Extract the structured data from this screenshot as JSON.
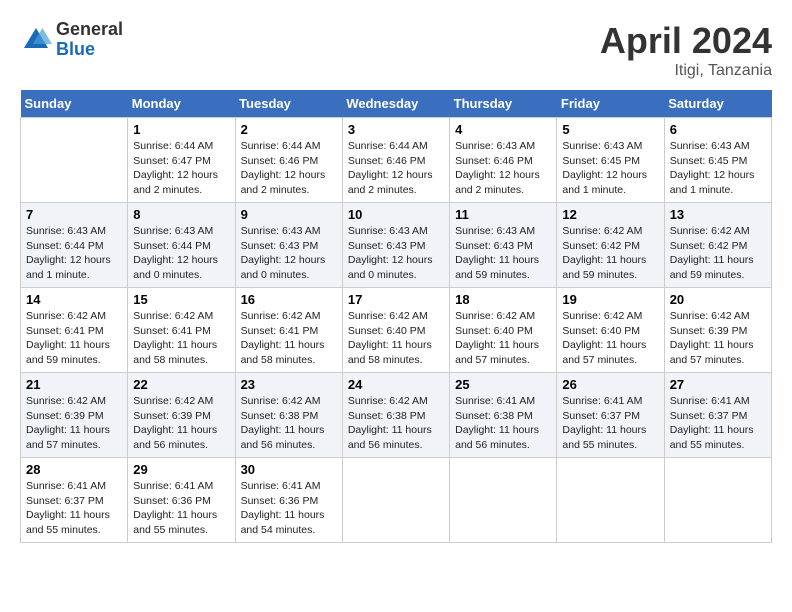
{
  "header": {
    "logo_general": "General",
    "logo_blue": "Blue",
    "month_title": "April 2024",
    "location": "Itigi, Tanzania"
  },
  "calendar": {
    "headers": [
      "Sunday",
      "Monday",
      "Tuesday",
      "Wednesday",
      "Thursday",
      "Friday",
      "Saturday"
    ],
    "weeks": [
      [
        {
          "day": "",
          "info": ""
        },
        {
          "day": "1",
          "info": "Sunrise: 6:44 AM\nSunset: 6:47 PM\nDaylight: 12 hours\nand 2 minutes."
        },
        {
          "day": "2",
          "info": "Sunrise: 6:44 AM\nSunset: 6:46 PM\nDaylight: 12 hours\nand 2 minutes."
        },
        {
          "day": "3",
          "info": "Sunrise: 6:44 AM\nSunset: 6:46 PM\nDaylight: 12 hours\nand 2 minutes."
        },
        {
          "day": "4",
          "info": "Sunrise: 6:43 AM\nSunset: 6:46 PM\nDaylight: 12 hours\nand 2 minutes."
        },
        {
          "day": "5",
          "info": "Sunrise: 6:43 AM\nSunset: 6:45 PM\nDaylight: 12 hours\nand 1 minute."
        },
        {
          "day": "6",
          "info": "Sunrise: 6:43 AM\nSunset: 6:45 PM\nDaylight: 12 hours\nand 1 minute."
        }
      ],
      [
        {
          "day": "7",
          "info": "Sunrise: 6:43 AM\nSunset: 6:44 PM\nDaylight: 12 hours\nand 1 minute."
        },
        {
          "day": "8",
          "info": "Sunrise: 6:43 AM\nSunset: 6:44 PM\nDaylight: 12 hours\nand 0 minutes."
        },
        {
          "day": "9",
          "info": "Sunrise: 6:43 AM\nSunset: 6:43 PM\nDaylight: 12 hours\nand 0 minutes."
        },
        {
          "day": "10",
          "info": "Sunrise: 6:43 AM\nSunset: 6:43 PM\nDaylight: 12 hours\nand 0 minutes."
        },
        {
          "day": "11",
          "info": "Sunrise: 6:43 AM\nSunset: 6:43 PM\nDaylight: 11 hours\nand 59 minutes."
        },
        {
          "day": "12",
          "info": "Sunrise: 6:42 AM\nSunset: 6:42 PM\nDaylight: 11 hours\nand 59 minutes."
        },
        {
          "day": "13",
          "info": "Sunrise: 6:42 AM\nSunset: 6:42 PM\nDaylight: 11 hours\nand 59 minutes."
        }
      ],
      [
        {
          "day": "14",
          "info": "Sunrise: 6:42 AM\nSunset: 6:41 PM\nDaylight: 11 hours\nand 59 minutes."
        },
        {
          "day": "15",
          "info": "Sunrise: 6:42 AM\nSunset: 6:41 PM\nDaylight: 11 hours\nand 58 minutes."
        },
        {
          "day": "16",
          "info": "Sunrise: 6:42 AM\nSunset: 6:41 PM\nDaylight: 11 hours\nand 58 minutes."
        },
        {
          "day": "17",
          "info": "Sunrise: 6:42 AM\nSunset: 6:40 PM\nDaylight: 11 hours\nand 58 minutes."
        },
        {
          "day": "18",
          "info": "Sunrise: 6:42 AM\nSunset: 6:40 PM\nDaylight: 11 hours\nand 57 minutes."
        },
        {
          "day": "19",
          "info": "Sunrise: 6:42 AM\nSunset: 6:40 PM\nDaylight: 11 hours\nand 57 minutes."
        },
        {
          "day": "20",
          "info": "Sunrise: 6:42 AM\nSunset: 6:39 PM\nDaylight: 11 hours\nand 57 minutes."
        }
      ],
      [
        {
          "day": "21",
          "info": "Sunrise: 6:42 AM\nSunset: 6:39 PM\nDaylight: 11 hours\nand 57 minutes."
        },
        {
          "day": "22",
          "info": "Sunrise: 6:42 AM\nSunset: 6:39 PM\nDaylight: 11 hours\nand 56 minutes."
        },
        {
          "day": "23",
          "info": "Sunrise: 6:42 AM\nSunset: 6:38 PM\nDaylight: 11 hours\nand 56 minutes."
        },
        {
          "day": "24",
          "info": "Sunrise: 6:42 AM\nSunset: 6:38 PM\nDaylight: 11 hours\nand 56 minutes."
        },
        {
          "day": "25",
          "info": "Sunrise: 6:41 AM\nSunset: 6:38 PM\nDaylight: 11 hours\nand 56 minutes."
        },
        {
          "day": "26",
          "info": "Sunrise: 6:41 AM\nSunset: 6:37 PM\nDaylight: 11 hours\nand 55 minutes."
        },
        {
          "day": "27",
          "info": "Sunrise: 6:41 AM\nSunset: 6:37 PM\nDaylight: 11 hours\nand 55 minutes."
        }
      ],
      [
        {
          "day": "28",
          "info": "Sunrise: 6:41 AM\nSunset: 6:37 PM\nDaylight: 11 hours\nand 55 minutes."
        },
        {
          "day": "29",
          "info": "Sunrise: 6:41 AM\nSunset: 6:36 PM\nDaylight: 11 hours\nand 55 minutes."
        },
        {
          "day": "30",
          "info": "Sunrise: 6:41 AM\nSunset: 6:36 PM\nDaylight: 11 hours\nand 54 minutes."
        },
        {
          "day": "",
          "info": ""
        },
        {
          "day": "",
          "info": ""
        },
        {
          "day": "",
          "info": ""
        },
        {
          "day": "",
          "info": ""
        }
      ]
    ]
  }
}
